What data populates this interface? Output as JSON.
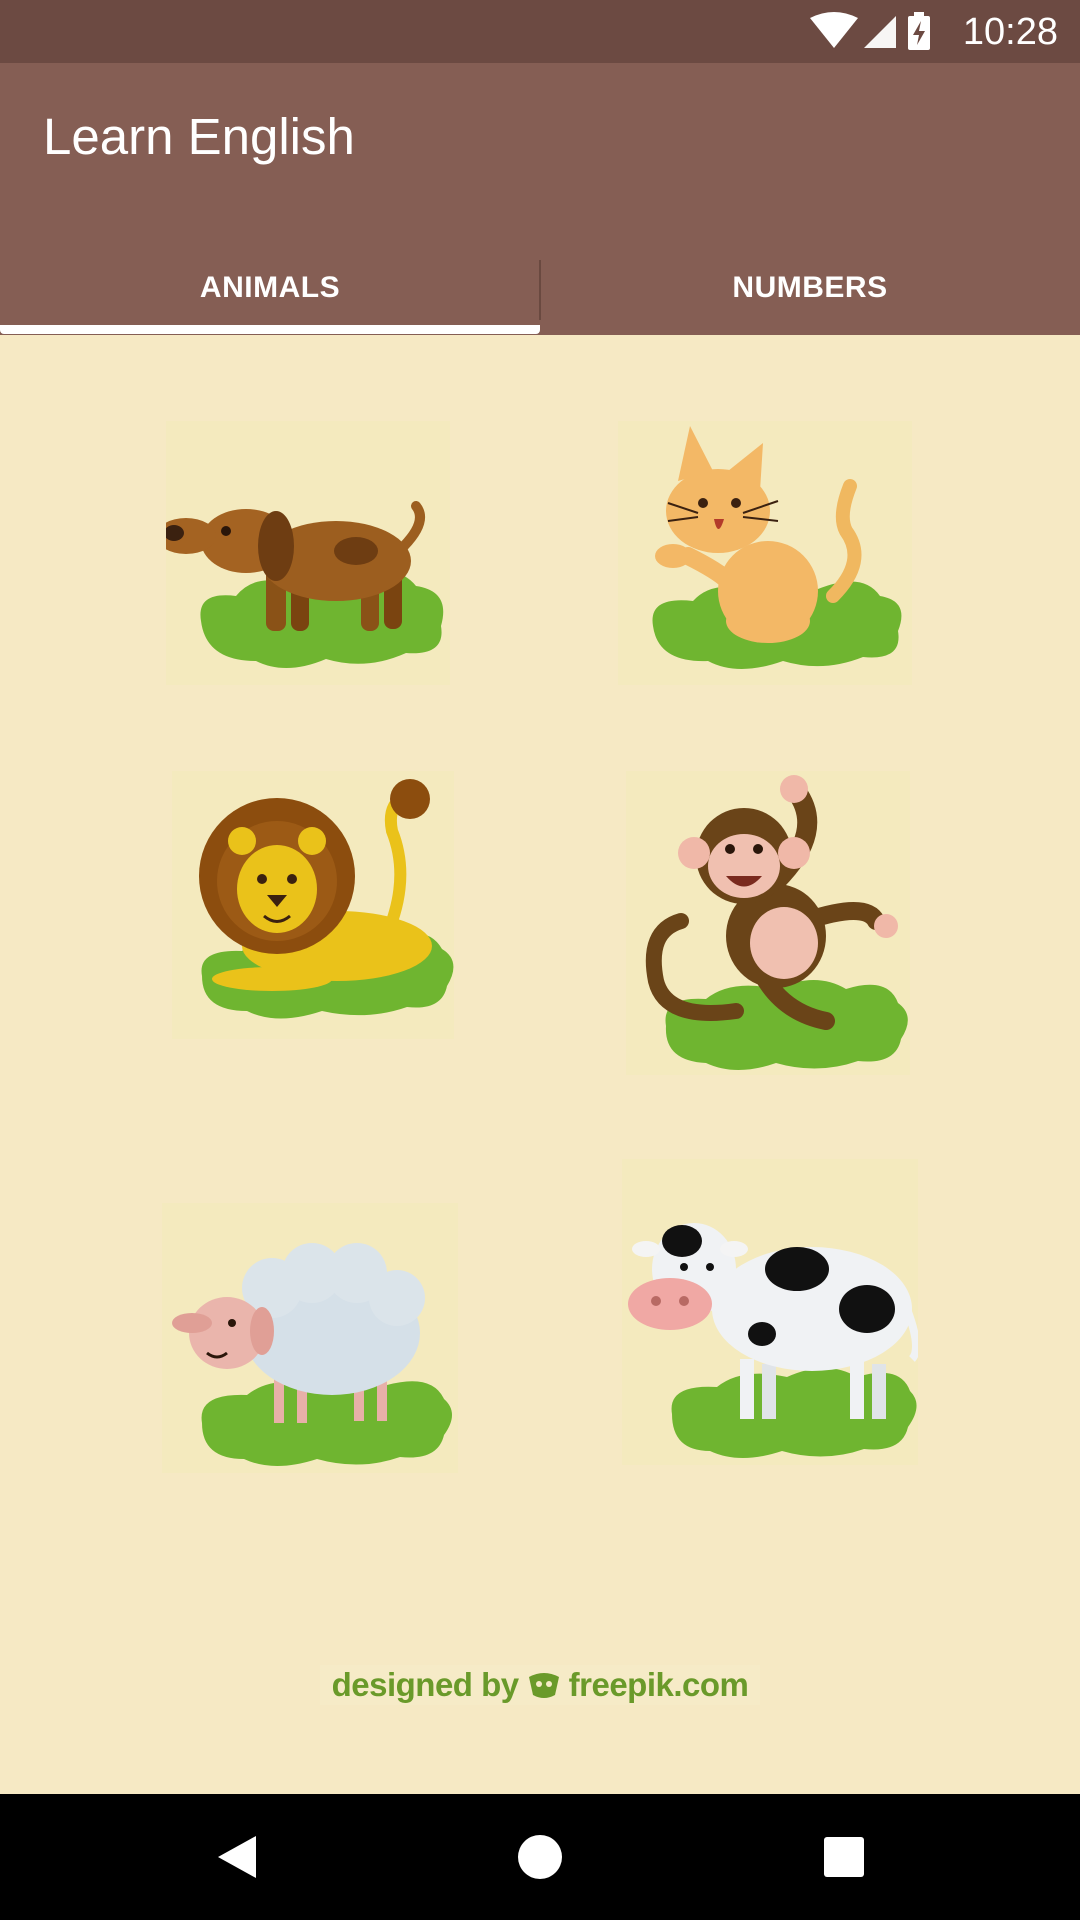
{
  "status_bar": {
    "time": "10:28",
    "icons": [
      "wifi-icon",
      "cell-signal-icon",
      "battery-charging-icon"
    ]
  },
  "app_bar": {
    "title": "Learn English",
    "background": "#855e54"
  },
  "tabs": [
    {
      "label": "ANIMALS",
      "selected": true
    },
    {
      "label": "NUMBERS",
      "selected": false
    }
  ],
  "animals": [
    {
      "name": "dog"
    },
    {
      "name": "cat"
    },
    {
      "name": "lion"
    },
    {
      "name": "monkey"
    },
    {
      "name": "sheep"
    },
    {
      "name": "cow"
    }
  ],
  "credit": {
    "prefix": "designed by",
    "brand": "freepik.com"
  },
  "nav_bar": {
    "buttons": [
      "back-icon",
      "home-icon",
      "recents-icon"
    ]
  },
  "colors": {
    "status_bar": "#6c4a42",
    "content_background": "#f6e9c4",
    "grass": "#6fb530"
  }
}
